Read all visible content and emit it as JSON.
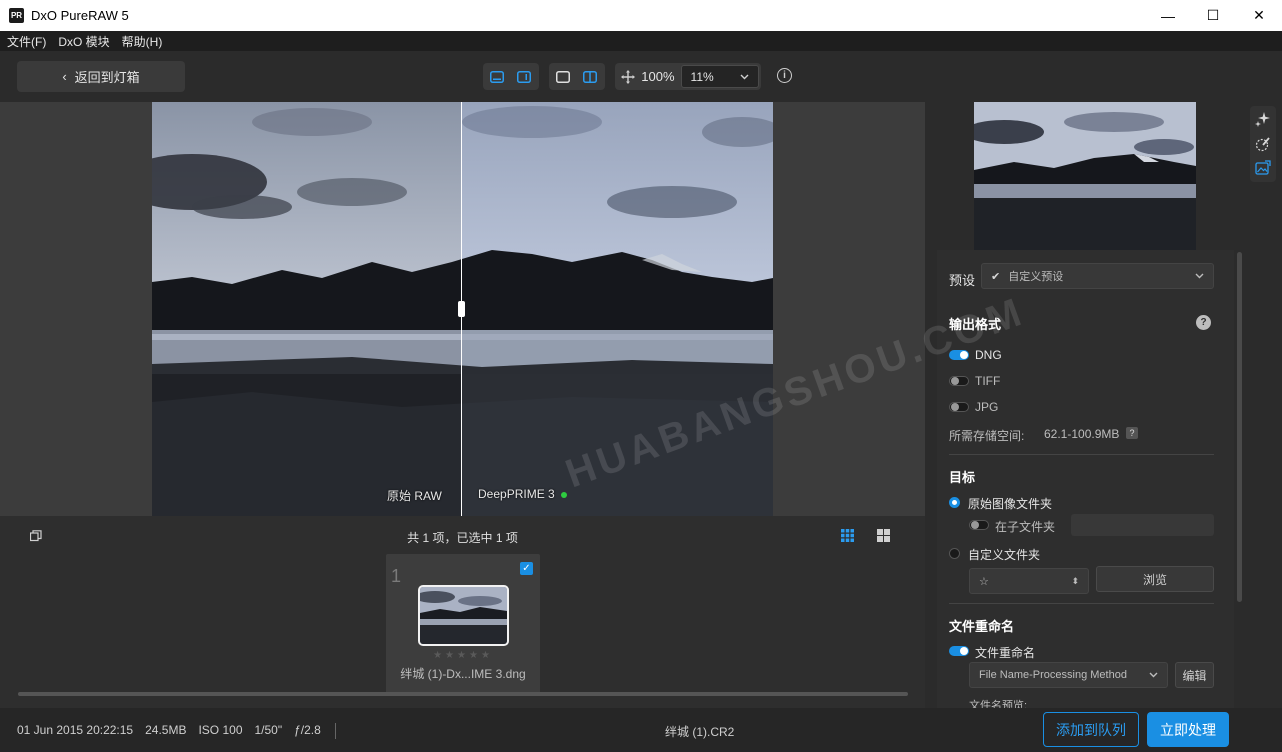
{
  "window": {
    "logo_text": "PR",
    "title": "DxO PureRAW 5",
    "minimize": "—",
    "maximize": "☐",
    "close": "✕"
  },
  "menu": [
    "文件(F)",
    "DxO 模块",
    "帮助(H)"
  ],
  "toolbar": {
    "back_label": "返回到灯箱",
    "zoom_fit": "100%",
    "zoom_value": "11%"
  },
  "viewer": {
    "left_label": "原始 RAW",
    "right_label": "DeepPRIME 3"
  },
  "filmstrip": {
    "count_text": "共 1 项，已选中 1 项",
    "item": {
      "index": "1",
      "stars": "★★★★★",
      "filename": "绊城 (1)-Dx...IME 3.dng"
    }
  },
  "status": {
    "date": "01 Jun 2015 20:22:15",
    "size": "24.5MB",
    "iso": "ISO 100",
    "shutter": "1/50\"",
    "aperture": "ƒ/2.8",
    "center_filename": "绊城 (1).CR2",
    "queue_button": "添加到队列",
    "process_button": "立即处理"
  },
  "panel": {
    "preset_label": "预设",
    "preset_value": "自定义预设",
    "output_format_heading": "输出格式",
    "formats": [
      {
        "label": "DNG",
        "enabled": true
      },
      {
        "label": "TIFF",
        "enabled": false
      },
      {
        "label": "JPG",
        "enabled": false
      }
    ],
    "storage_label": "所需存储空间:",
    "storage_value": "62.1-100.9MB",
    "target_heading": "目标",
    "original_folder": "原始图像文件夹",
    "subfolder": "在子文件夹",
    "custom_folder": "自定义文件夹",
    "folder_select": "☆",
    "browse_button": "浏览",
    "rename_heading": "文件重命名",
    "rename_toggle": "文件重命名",
    "rename_select": "File Name-Processing Method",
    "edit_button": "编辑",
    "filename_preview_label": "文件名预览:"
  },
  "watermark": "HUABANGSHOU.COM",
  "colors": {
    "accent": "#1a8fe3",
    "background": "#2b2b2b",
    "status_ok": "#2ecc40"
  }
}
